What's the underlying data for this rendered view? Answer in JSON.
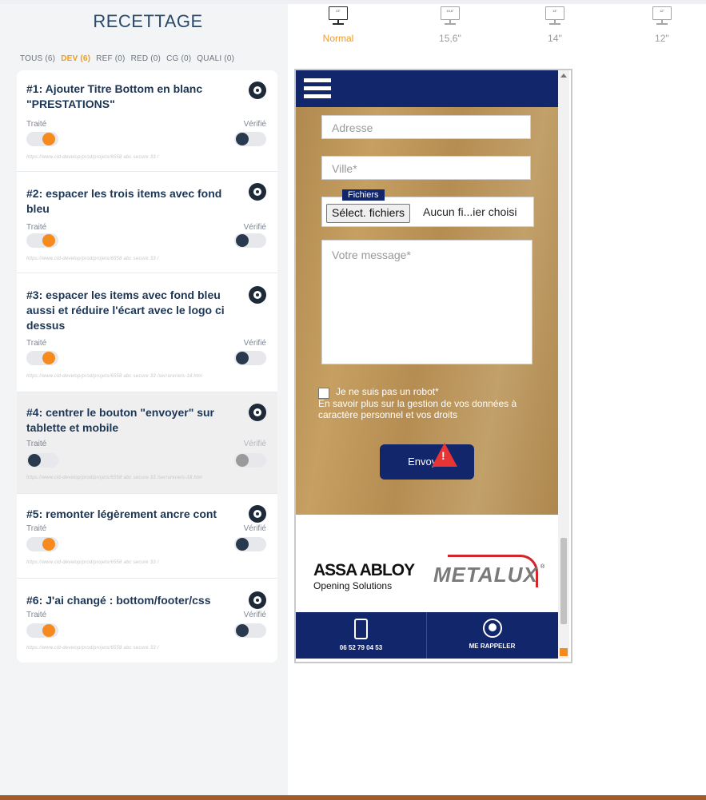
{
  "recettage": {
    "title": "RECETTAGE"
  },
  "filters": [
    {
      "label": "TOUS (6)"
    },
    {
      "label": "DEV (6)"
    },
    {
      "label": "REF (0)"
    },
    {
      "label": "RED (0)"
    },
    {
      "label": "CG (0)"
    },
    {
      "label": "QUALI (0)"
    }
  ],
  "cards": [
    {
      "title": "#1: Ajouter Titre Bottom en blanc \"PRESTATIONS\"",
      "traite": "Traité",
      "verifie": "Vérifié",
      "url": "https://www.cld-develop/prod/projets/6558 abc secure 33 /"
    },
    {
      "title": "#2: espacer les trois items avec fond bleu",
      "traite": "Traité",
      "verifie": "Vérifié",
      "url": "https://www.cld-develop/prod/projets/6558 abc secure 33 /"
    },
    {
      "title": "#3: espacer les items avec fond bleu aussi et réduire l'écart avec le logo ci dessus",
      "traite": "Traité",
      "verifie": "Vérifié",
      "url": "https://www.cld-develop/prod/projets/6558 abc secure 33 /serrurerie/s-18.htm"
    },
    {
      "title": "#4: centrer le bouton \"envoyer\" sur tablette et mobile",
      "traite": "Traité",
      "verifie": "Vérifié",
      "url": "https://www.cld-develop/prod/projets/6558 abc secure 33 /serrurerie/s-18.htm"
    },
    {
      "title": "#5: remonter légèrement ancre cont",
      "traite": "Traité",
      "verifie": "Vérifié",
      "url": "https://www.cld-develop/prod/projets/6558 abc secure 33 /"
    },
    {
      "title": "#6: J'ai changé : bottom/footer/css",
      "traite": "Traité",
      "verifie": "Vérifié",
      "url": "https://www.cld-develop/prod/projets/6558 abc secure 33 /"
    }
  ],
  "devices": [
    {
      "label": "Normal",
      "screen": "23\""
    },
    {
      "label": "15,6''",
      "screen": "15,6\""
    },
    {
      "label": "14''",
      "screen": "14\""
    },
    {
      "label": "12''",
      "screen": "12\""
    }
  ],
  "preview": {
    "address_placeholder": "Adresse",
    "city_placeholder": "Ville*",
    "files_tag": "Fichiers",
    "file_button": "Sélect. fichiers",
    "file_status": "Aucun fi...ier choisi",
    "message_placeholder": "Votre message*",
    "robot": "Je ne suis pas un robot*",
    "privacy": "En savoir plus sur la gestion de vos données à caractère personnel et vos droits",
    "send": "Envoyer",
    "assa_brand": "ASSA ABLOY",
    "assa_sub": "Opening Solutions",
    "metalux": "METALUX",
    "reg": "®",
    "phone": "06 52 79 04 53",
    "callback": "ME RAPPELER"
  }
}
